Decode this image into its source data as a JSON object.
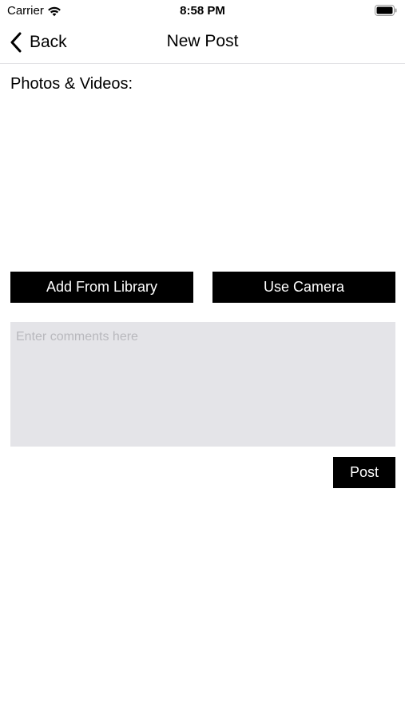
{
  "status_bar": {
    "carrier": "Carrier",
    "time": "8:58 PM",
    "icons": [
      "wifi-icon",
      "battery-icon"
    ]
  },
  "nav": {
    "back_label": "Back",
    "back_icon": "chevron-left-icon",
    "title": "New Post"
  },
  "main": {
    "section_label": "Photos & Videos:",
    "add_from_library_label": "Add From Library",
    "use_camera_label": "Use Camera",
    "comments": {
      "value": "",
      "placeholder": "Enter comments here"
    },
    "post_label": "Post"
  },
  "colors": {
    "button_background": "#000000",
    "button_text": "#ffffff",
    "comments_background": "#e4e4e8",
    "placeholder_text": "#b8b8bd"
  }
}
